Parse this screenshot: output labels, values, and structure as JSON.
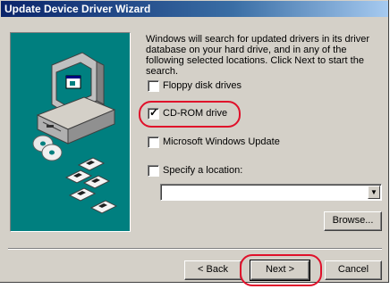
{
  "window": {
    "title": "Update Device Driver Wizard"
  },
  "description": "Windows will search for updated drivers in its driver database on your hard drive, and in any of the following selected locations. Click Next to start the search.",
  "options": [
    {
      "label": "Floppy disk drives",
      "checked": false
    },
    {
      "label": "CD-ROM drive",
      "checked": true
    },
    {
      "label": "Microsoft Windows Update",
      "checked": false
    },
    {
      "label": "Specify a location:",
      "checked": false
    }
  ],
  "location_field": {
    "value": ""
  },
  "buttons": {
    "browse": "Browse...",
    "back": "< Back",
    "next": "Next >",
    "cancel": "Cancel"
  },
  "colors": {
    "highlight": "#e0102a",
    "title_bg": "#0a246a",
    "illustration_bg": "#007f7f"
  }
}
